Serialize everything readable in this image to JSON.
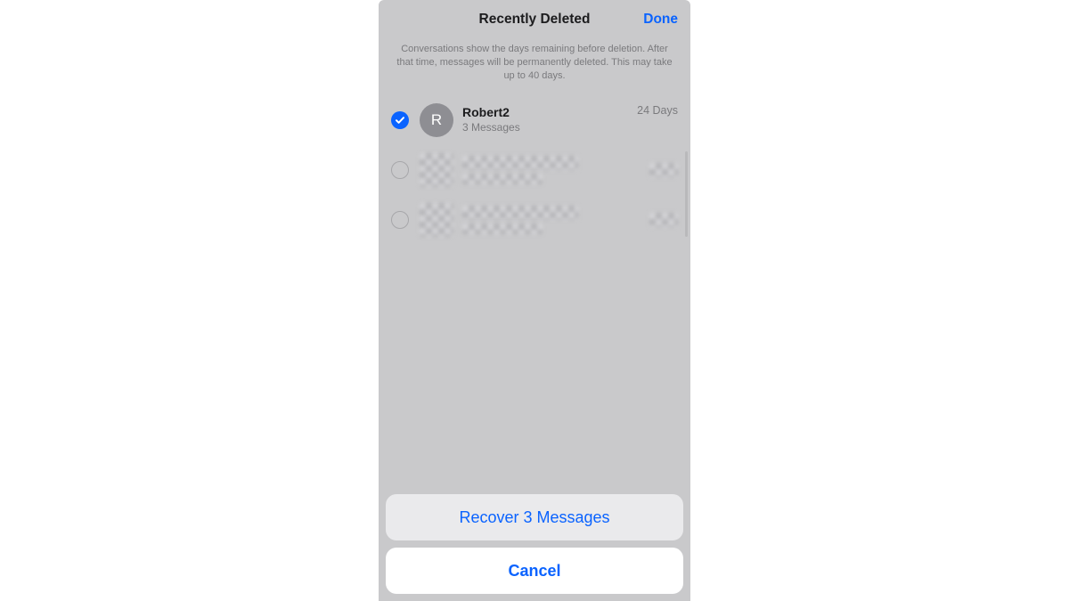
{
  "header": {
    "title": "Recently Deleted",
    "done_label": "Done"
  },
  "description": "Conversations show the days remaining before deletion. After that time, messages will be permanently deleted. This may take up to 40 days.",
  "conversations": [
    {
      "selected": true,
      "avatar_initial": "R",
      "name": "Robert2",
      "subtitle": "3 Messages",
      "days_label": "24 Days",
      "redacted": false
    },
    {
      "selected": false,
      "redacted": true
    },
    {
      "selected": false,
      "redacted": true
    }
  ],
  "actions": {
    "recover_label": "Recover 3 Messages",
    "cancel_label": "Cancel"
  }
}
